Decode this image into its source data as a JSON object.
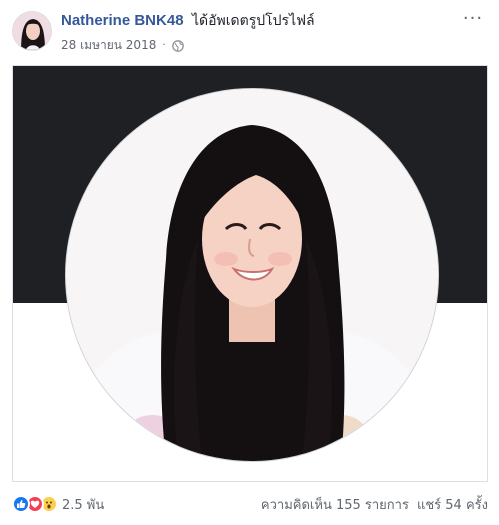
{
  "post": {
    "author": "Natherine BNK48",
    "action": "ได้อัพเดตรูปโปรไฟล์",
    "date": "28 เมษายน 2018",
    "separator": "·",
    "privacy_icon": "globe-icon",
    "more_icon": "more-dots-icon",
    "more_label": "···"
  },
  "photo": {
    "cover_color": "#1e2024",
    "frame_color": "#ffffff"
  },
  "footer": {
    "reaction_icons": [
      "like-icon",
      "love-icon",
      "wow-icon"
    ],
    "reaction_count": "2.5 พัน",
    "comments": "ความคิดเห็น 155 รายการ",
    "shares": "แชร์ 54 ครั้ง"
  },
  "colors": {
    "link": "#365899",
    "meta": "#616770",
    "like": "#1877f2",
    "love": "#f33e58",
    "wow": "#fcd04f"
  }
}
